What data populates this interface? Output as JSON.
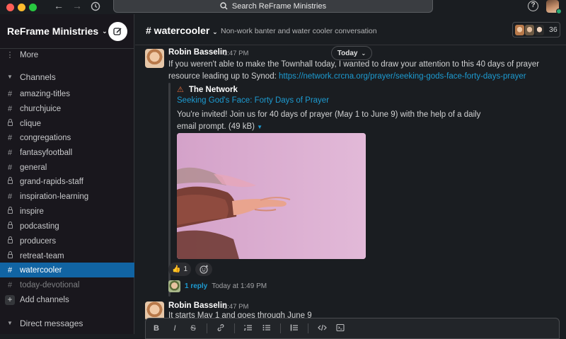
{
  "search": {
    "label": "Search ReFrame Ministries"
  },
  "toolbar": {
    "help_label": "?"
  },
  "sidebar": {
    "workspace": "ReFrame Ministries",
    "more_label": "More",
    "channels_label": "Channels",
    "channels": [
      {
        "name": "amazing-titles",
        "kind": "public"
      },
      {
        "name": "churchjuice",
        "kind": "public"
      },
      {
        "name": "clique",
        "kind": "private"
      },
      {
        "name": "congregations",
        "kind": "public"
      },
      {
        "name": "fantasyfootball",
        "kind": "public"
      },
      {
        "name": "general",
        "kind": "public"
      },
      {
        "name": "grand-rapids-staff",
        "kind": "private"
      },
      {
        "name": "inspiration-learning",
        "kind": "public"
      },
      {
        "name": "inspire",
        "kind": "private"
      },
      {
        "name": "podcasting",
        "kind": "private"
      },
      {
        "name": "producers",
        "kind": "private"
      },
      {
        "name": "retreat-team",
        "kind": "private"
      },
      {
        "name": "watercooler",
        "kind": "public",
        "active": true
      },
      {
        "name": "today-devotional",
        "kind": "public",
        "muted": true
      }
    ],
    "add_channels_label": "Add channels",
    "direct_messages_label": "Direct messages"
  },
  "channel": {
    "name": "# watercooler",
    "topic": "Non-work banter and water cooler conversation",
    "member_count": "36"
  },
  "messages": [
    {
      "author": "Robin Basselin",
      "time": "1:47 PM",
      "text": "If you weren't able to make the Townhall today, I wanted to draw your attention to this 40 days of prayer resource leading up to Synod: ",
      "link": "https://network.crcna.org/prayer/seeking-gods-face-forty-days-prayer",
      "attachment": {
        "source": "The Network",
        "title": "Seeking God's Face: Forty Days of Prayer",
        "description": "You're invited! Join us for 40 days of prayer (May 1 to June 9) with the help of a daily email prompt.",
        "size": "(49 kB)"
      },
      "reactions": [
        {
          "emoji": "👍",
          "count": "1"
        }
      ],
      "thread": {
        "replies": "1 reply",
        "time": "Today at 1:49 PM"
      }
    },
    {
      "author": "Robin Basselin",
      "time": "1:47 PM",
      "text": "It starts May 1 and goes through June 9"
    }
  ],
  "date_divider": "Today",
  "composer": {
    "tools": [
      "B",
      "I",
      "S",
      "link",
      "ordered-list",
      "bullet-list",
      "blockquote",
      "code",
      "code-block"
    ]
  },
  "colors": {
    "accent": "#1164a3",
    "link": "#1d9bd1",
    "presence": "#2bac76"
  }
}
